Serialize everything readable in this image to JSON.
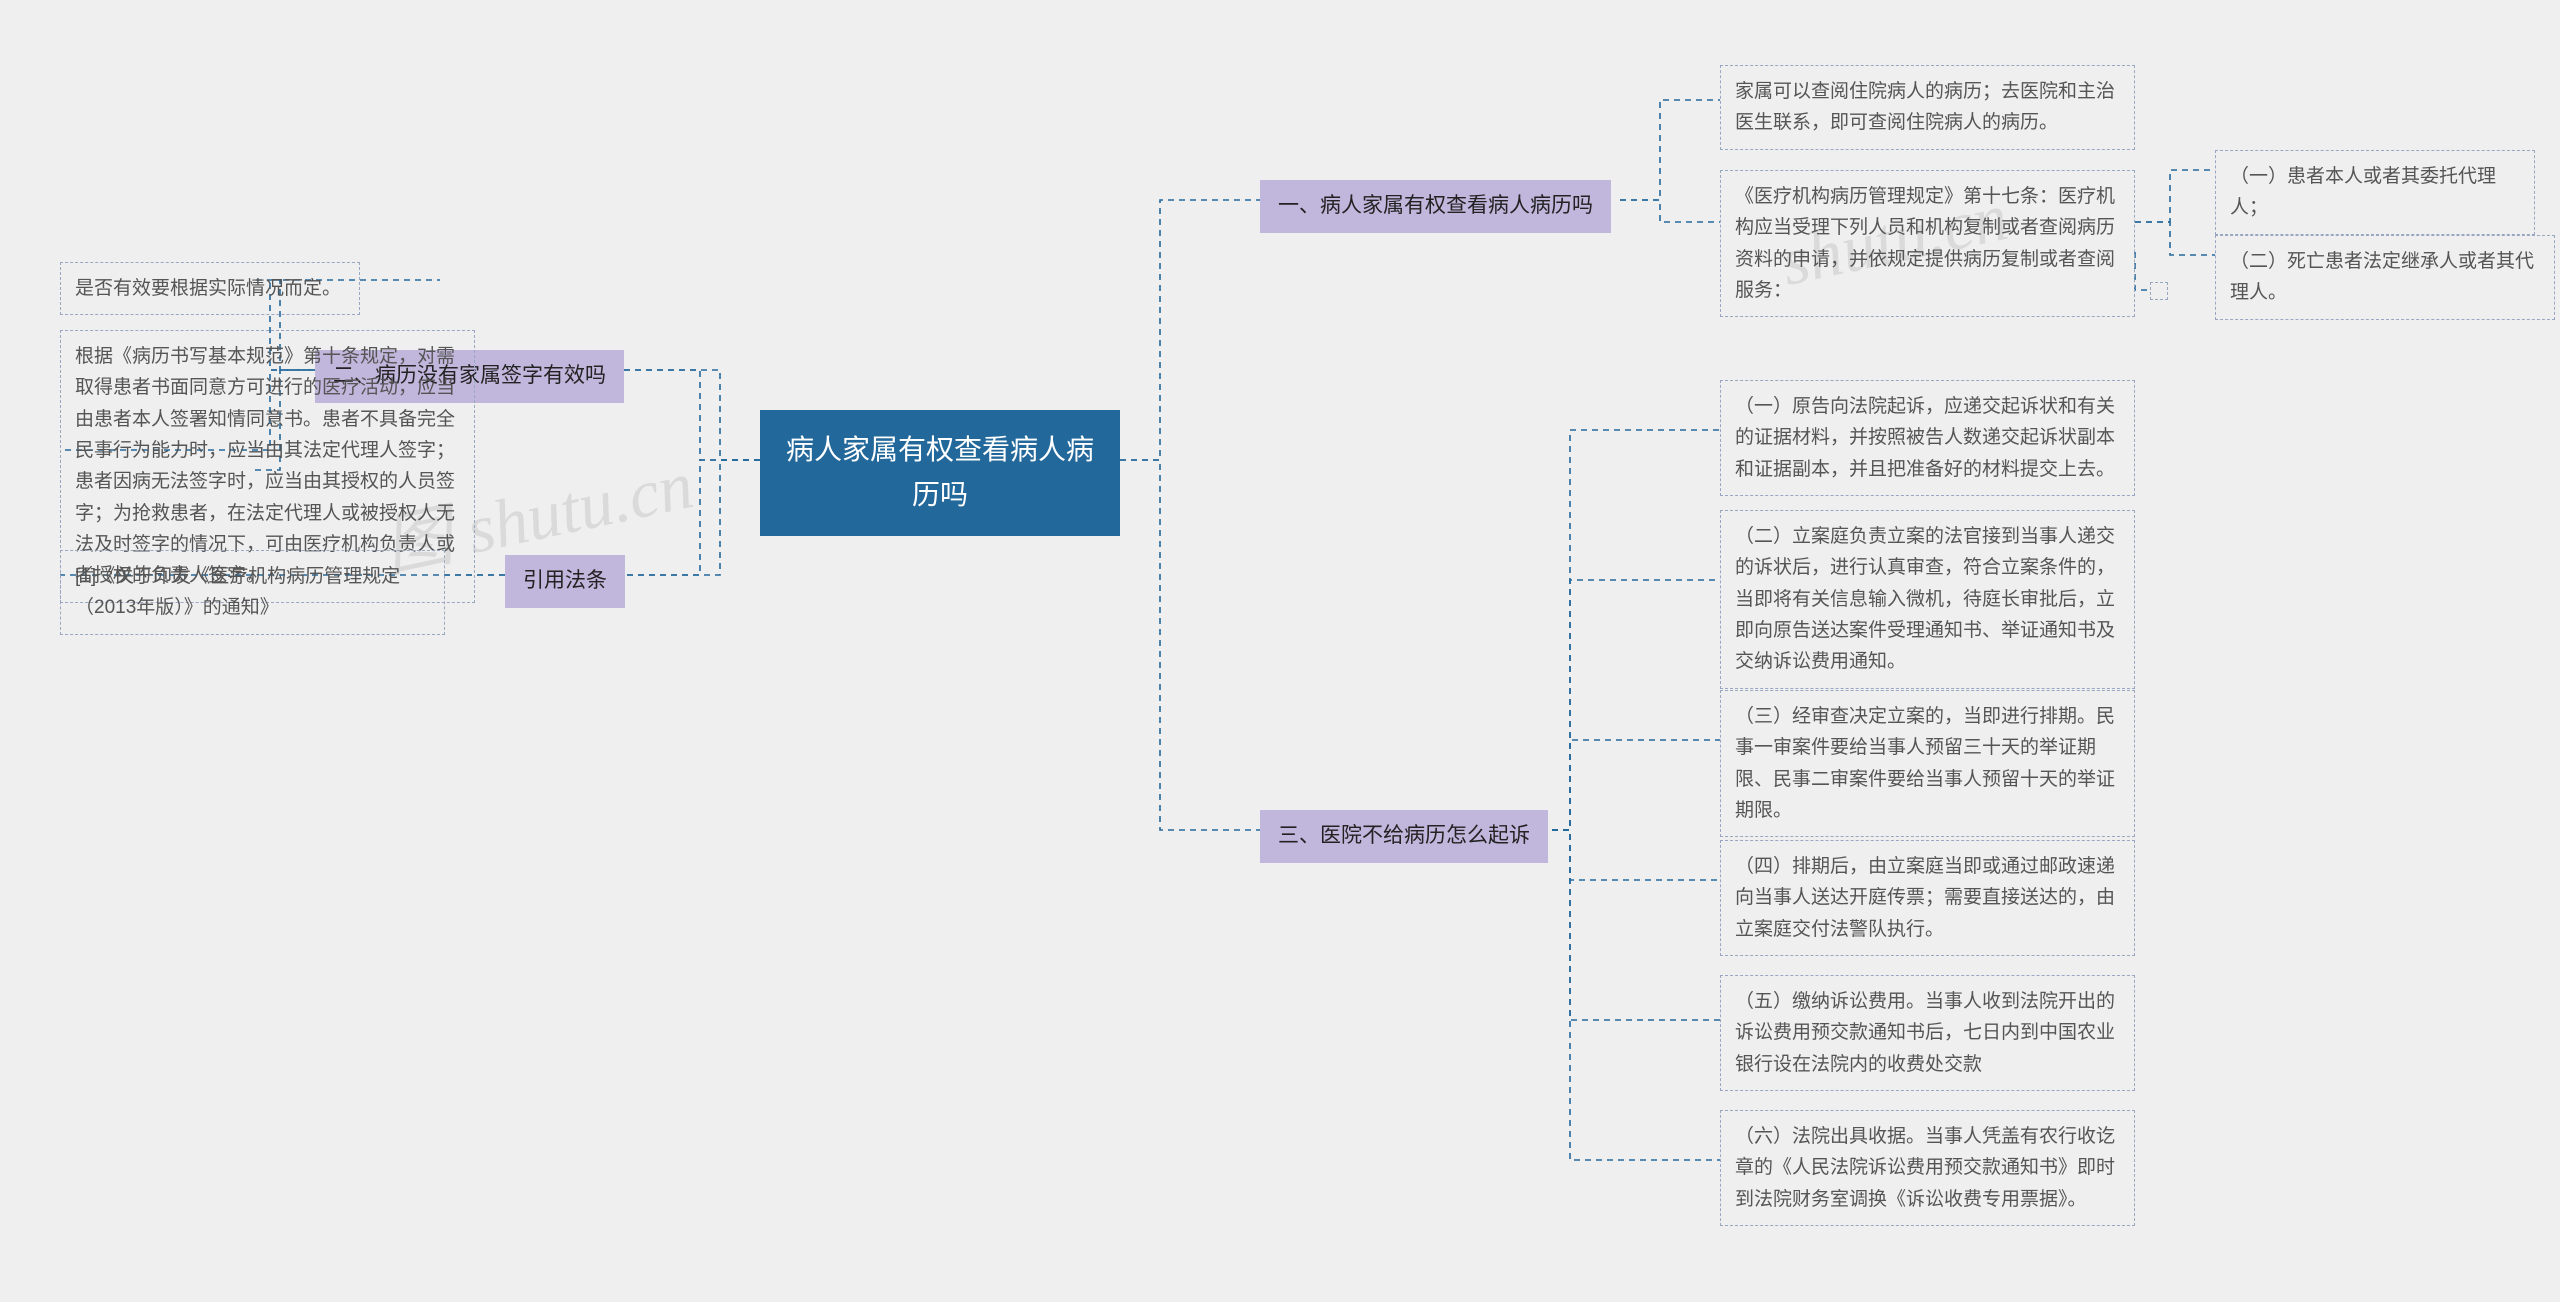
{
  "root": {
    "title": "病人家属有权查看病人病\n历吗"
  },
  "right": {
    "b1": {
      "label": "一、病人家属有权查看病人病历吗",
      "c1": "家属可以查阅住院病人的病历；去医院和主治医生联系，即可查阅住院病人的病历。",
      "c2": "《医疗机构病历管理规定》第十七条：医疗机构应当受理下列人员和机构复制或者查阅病历资料的申请，并依规定提供病历复制或者查阅服务：",
      "c2a": "（一）患者本人或者其委托代理人；",
      "c2b": "（二）死亡患者法定继承人或者其代理人。"
    },
    "b3": {
      "label": "三、医院不给病历怎么起诉",
      "c1": "（一）原告向法院起诉，应递交起诉状和有关的证据材料，并按照被告人数递交起诉状副本和证据副本，并且把准备好的材料提交上去。",
      "c2": "（二）立案庭负责立案的法官接到当事人递交的诉状后，进行认真审查，符合立案条件的，当即将有关信息输入微机，待庭长审批后，立即向原告送达案件受理通知书、举证通知书及交纳诉讼费用通知。",
      "c3": "（三）经审查决定立案的，当即进行排期。民事一审案件要给当事人预留三十天的举证期限、民事二审案件要给当事人预留十天的举证期限。",
      "c4": "（四）排期后，由立案庭当即或通过邮政速递向当事人送达开庭传票；需要直接送达的，由立案庭交付法警队执行。",
      "c5": "（五）缴纳诉讼费用。当事人收到法院开出的诉讼费用预交款通知书后，七日内到中国农业银行设在法院内的收费处交款",
      "c6": "（六）法院出具收据。当事人凭盖有农行收讫章的《人民法院诉讼费用预交款通知书》即时到法院财务室调换《诉讼收费专用票据》。"
    }
  },
  "left": {
    "b2": {
      "label": "二、病历没有家属签字有效吗",
      "c1": "是否有效要根据实际情况而定。",
      "c2": "根据《病历书写基本规范》第十条规定，对需取得患者书面同意方可进行的医疗活动，应当由患者本人签署知情同意书。患者不具备完全民事行为能力时，应当由其法定代理人签字；患者因病无法签字时，应当由其授权的人员签字；为抢救患者，在法定代理人或被授权人无法及时签字的情况下，可由医疗机构负责人或者授权的负责人签字。"
    },
    "bRef": {
      "label": "引用法条",
      "c1": "[1]《关于印发《医疗机构病历管理规定（2013年版）》的通知》"
    }
  },
  "watermarks": {
    "w1": "图 shutu.cn",
    "w2": "shutu.cn"
  }
}
